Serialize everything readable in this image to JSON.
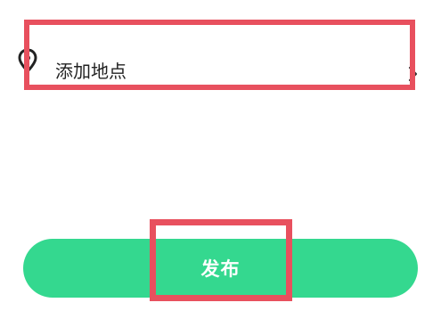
{
  "location": {
    "label": "添加地点",
    "icon": "location-pin-icon",
    "chevron": "chevron-right-icon"
  },
  "publish": {
    "label": "发布",
    "color": "#34d88f"
  },
  "annotation_color": "#e8505e"
}
